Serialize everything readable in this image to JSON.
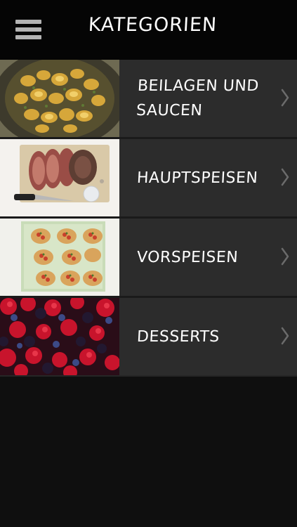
{
  "header": {
    "title": "KATEGORIEN",
    "menu_icon": "hamburger-menu-icon"
  },
  "categories": [
    {
      "label_line1": "BEILAGEN UND",
      "label_line2": "SAUCEN",
      "image": "fried-potatoes-photo"
    },
    {
      "label_line1": "HAUPTSPEISEN",
      "label_line2": "",
      "image": "roast-beef-photo"
    },
    {
      "label_line1": "VORSPEISEN",
      "label_line2": "",
      "image": "bruschetta-photo"
    },
    {
      "label_line1": "DESSERTS",
      "label_line2": "",
      "image": "berries-photo"
    }
  ],
  "colors": {
    "header_bg": "#050505",
    "row_bg": "#2c2c2c",
    "page_bg": "#0f0f0f",
    "chevron": "#6b6b6b",
    "text": "#ffffff"
  }
}
